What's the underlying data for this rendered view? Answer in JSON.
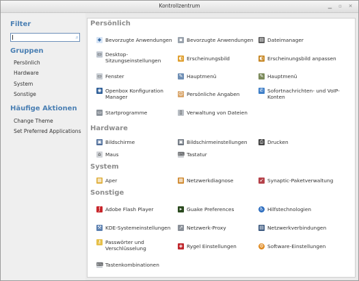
{
  "window": {
    "title": "Kontrollzentrum"
  },
  "sidebar": {
    "filter_heading": "Filter",
    "groups_heading": "Gruppen",
    "groups": [
      "Persönlich",
      "Hardware",
      "System",
      "Sonstige"
    ],
    "actions_heading": "Häufige Aktionen",
    "actions": [
      "Change Theme",
      "Set Preferred Applications"
    ]
  },
  "categories": {
    "personal": "Persönlich",
    "hardware": "Hardware",
    "system": "System",
    "other": "Sonstige"
  },
  "items": {
    "p1": "Bevorzugte Anwendungen",
    "p2": "Bevorzugte Anwendungen",
    "p3": "Dateimanager",
    "p4": "Desktop-Sitzungseinstellungen",
    "p5": "Erscheinungsbild",
    "p6": "Erscheinungsbild anpassen",
    "p7": "Fenster",
    "p8": "Hauptmenü",
    "p9": "Hauptmenü",
    "p10": "Openbox Konfiguration Manager",
    "p11": "Persönliche Angaben",
    "p12": "Sofortnachrichten- und VoIP-Konten",
    "p13": "Startprogramme",
    "p14": "Verwaltung von Dateien",
    "h1": "Bildschirme",
    "h2": "Bildschirmeinstellungen",
    "h3": "Drucken",
    "h4": "Maus",
    "h5": "Tastatur",
    "s1": "Aper",
    "s2": "Netzwerkdiagnose",
    "s3": "Synaptic-Paketverwaltung",
    "o1": "Adobe Flash Player",
    "o2": "Guake Preferences",
    "o3": "Hilfstechnologien",
    "o4": "KDE-Systemeinstellungen",
    "o5": "Netzwerk-Proxy",
    "o6": "Netzwerkverbindungen",
    "o7": "Passwörter und Verschlüsselung",
    "o8": "Rygel Einstellungen",
    "o9": "Software-Einstellungen",
    "o10": "Tastenkombinationen"
  }
}
